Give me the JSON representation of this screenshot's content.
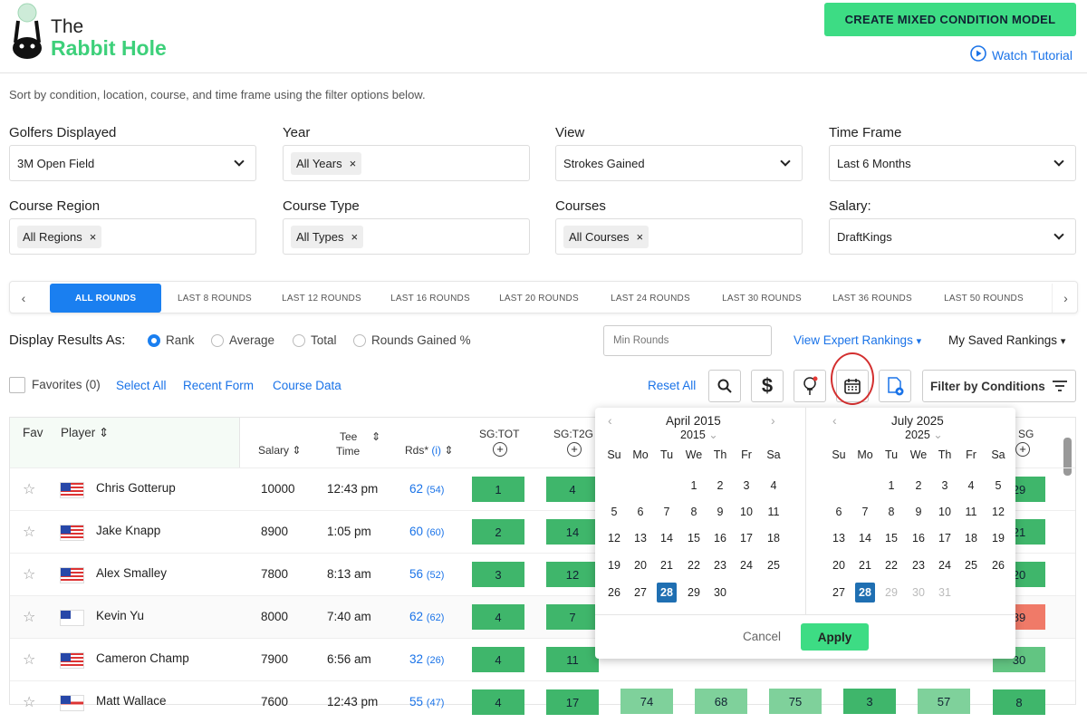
{
  "brand": {
    "name_line1": "The",
    "name_line2": "Rabbit Hole"
  },
  "header": {
    "create_button": "CREATE MIXED CONDITION MODEL",
    "tutorial_link": "Watch Tutorial"
  },
  "intro": "Sort by condition, location, course, and time frame using the filter options below.",
  "filters": {
    "golfers": {
      "label": "Golfers Displayed",
      "value": "3M Open Field"
    },
    "year": {
      "label": "Year",
      "chip": "All Years"
    },
    "view": {
      "label": "View",
      "value": "Strokes Gained"
    },
    "timeframe": {
      "label": "Time Frame",
      "value": "Last 6 Months"
    },
    "region": {
      "label": "Course Region",
      "chip": "All Regions"
    },
    "type": {
      "label": "Course Type",
      "chip": "All Types"
    },
    "courses": {
      "label": "Courses",
      "chip": "All Courses"
    },
    "salary": {
      "label": "Salary:",
      "value": "DraftKings"
    }
  },
  "tabs": [
    "ALL ROUNDS",
    "LAST 8 ROUNDS",
    "LAST 12 ROUNDS",
    "LAST 16 ROUNDS",
    "LAST 20 ROUNDS",
    "LAST 24 ROUNDS",
    "LAST 30 ROUNDS",
    "LAST 36 ROUNDS",
    "LAST 50 ROUNDS"
  ],
  "display": {
    "label": "Display Results As:",
    "options": [
      "Rank",
      "Average",
      "Total",
      "Rounds Gained %"
    ],
    "selected": "Rank",
    "min_rounds_placeholder": "Min Rounds",
    "expert_link": "View Expert Rankings",
    "saved": "My Saved Rankings"
  },
  "toolbar": {
    "favorites": "Favorites (0)",
    "select_all": "Select All",
    "recent_form": "Recent Form",
    "course_data": "Course Data",
    "reset_all": "Reset All",
    "filter_conditions": "Filter by Conditions"
  },
  "table": {
    "headers": {
      "fav": "Fav",
      "player": "Player",
      "salary": "Salary",
      "tee1": "Tee",
      "tee2": "Time",
      "rds": "Rds*",
      "rds_info": "(i)",
      "sgtot": "SG:TOT",
      "sgt2g": "SG:T2G",
      "last": "SG"
    },
    "rows": [
      {
        "name": "Chris Gotterup",
        "salary": "10000",
        "tee": "12:43 pm",
        "rds": "62",
        "rds2": "(54)",
        "sgtot": "1",
        "sgt2g": "4",
        "last": "29",
        "last_color": "#3fb66b"
      },
      {
        "name": "Jake Knapp",
        "salary": "8900",
        "tee": "1:05 pm",
        "rds": "60",
        "rds2": "(60)",
        "sgtot": "2",
        "sgt2g": "14",
        "last": "21",
        "last_color": "#3fb66b"
      },
      {
        "name": "Alex Smalley",
        "salary": "7800",
        "tee": "8:13 am",
        "rds": "56",
        "rds2": "(52)",
        "sgtot": "3",
        "sgt2g": "12",
        "last": "20",
        "last_color": "#3fb66b"
      },
      {
        "name": "Kevin Yu",
        "salary": "8000",
        "tee": "7:40 am",
        "rds": "62",
        "rds2": "(62)",
        "sgtot": "4",
        "sgt2g": "7",
        "last": "89",
        "last_color": "#f07a68"
      },
      {
        "name": "Cameron Champ",
        "salary": "7900",
        "tee": "6:56 am",
        "rds": "32",
        "rds2": "(26)",
        "sgtot": "4",
        "sgt2g": "11",
        "last": "30",
        "last_color": "#62c582"
      },
      {
        "name": "Matt Wallace",
        "salary": "7600",
        "tee": "12:43 pm",
        "rds": "55",
        "rds2": "(47)",
        "sgtot": "4",
        "sgt2g": "17",
        "last": "8",
        "last_color": "#3fb66b"
      }
    ],
    "extra_row6": [
      "74",
      "68",
      "75",
      "3",
      "57"
    ]
  },
  "calendar": {
    "left": {
      "month": "April 2015",
      "year": "2015"
    },
    "right": {
      "month": "July 2025",
      "year": "2025"
    },
    "dow": [
      "Su",
      "Mo",
      "Tu",
      "We",
      "Th",
      "Fr",
      "Sa"
    ],
    "cancel": "Cancel",
    "apply": "Apply"
  },
  "colors": {
    "green": "#3ddc84",
    "blue": "#1a7ff0",
    "cell_green": "#3fb66b"
  }
}
